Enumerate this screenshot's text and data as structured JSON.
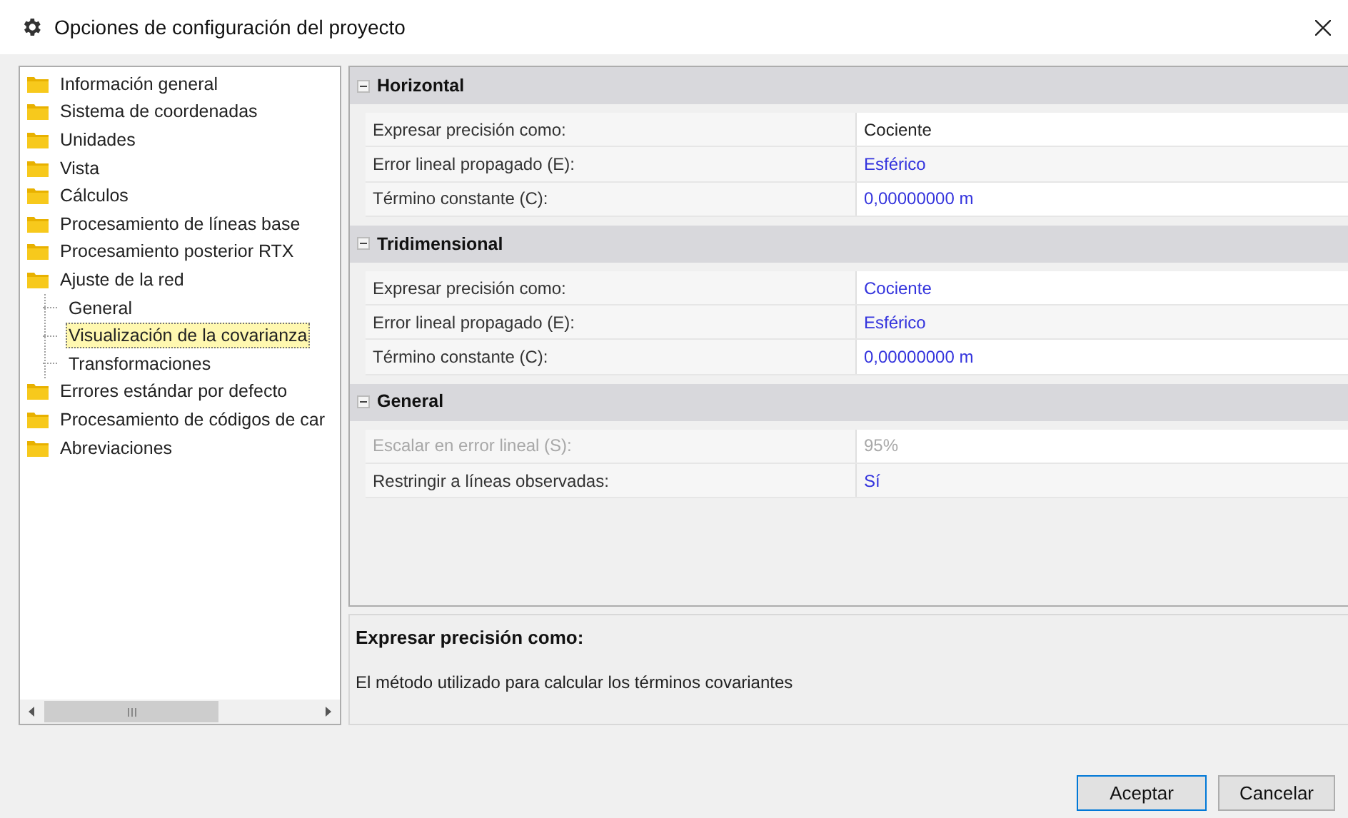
{
  "window": {
    "title": "Opciones de configuración del proyecto"
  },
  "tree": [
    {
      "label": "Información general",
      "selected": false
    },
    {
      "label": "Sistema de coordenadas",
      "selected": false
    },
    {
      "label": "Unidades",
      "selected": false
    },
    {
      "label": "Vista",
      "selected": false
    },
    {
      "label": "Cálculos",
      "selected": false
    },
    {
      "label": "Procesamiento de líneas base",
      "selected": false
    },
    {
      "label": "Procesamiento posterior RTX",
      "selected": false
    },
    {
      "label": "Ajuste de la red",
      "selected": false,
      "expanded": true,
      "children": [
        {
          "label": "General",
          "selected": false
        },
        {
          "label": "Visualización de la covarianza",
          "selected": true
        },
        {
          "label": "Transformaciones",
          "selected": false
        }
      ]
    },
    {
      "label": "Errores estándar por defecto",
      "selected": false
    },
    {
      "label": "Procesamiento de códigos de car",
      "selected": false
    },
    {
      "label": "Abreviaciones",
      "selected": false
    }
  ],
  "property_grid": [
    {
      "title": "Horizontal",
      "expanded": true,
      "rows": [
        {
          "label": "Expresar precisión como:",
          "value": "Cociente",
          "modified": false,
          "disabled": false
        },
        {
          "label": "Error lineal propagado (E):",
          "value": "Esférico",
          "modified": true,
          "disabled": false
        },
        {
          "label": "Término constante (C):",
          "value": "0,00000000 m",
          "modified": true,
          "disabled": false
        }
      ]
    },
    {
      "title": "Tridimensional",
      "expanded": true,
      "rows": [
        {
          "label": "Expresar precisión como:",
          "value": "Cociente",
          "modified": true,
          "disabled": false
        },
        {
          "label": "Error lineal propagado (E):",
          "value": "Esférico",
          "modified": true,
          "disabled": false
        },
        {
          "label": "Término constante (C):",
          "value": "0,00000000 m",
          "modified": true,
          "disabled": false
        }
      ]
    },
    {
      "title": "General",
      "expanded": true,
      "rows": [
        {
          "label": "Escalar en error lineal (S):",
          "value": "95%",
          "disabled": true
        },
        {
          "label": "Restringir a líneas observadas:",
          "value": "Sí",
          "modified": true,
          "disabled": false
        }
      ]
    }
  ],
  "description": {
    "title": "Expresar precisión como:",
    "text": "El método utilizado para calcular los términos covariantes"
  },
  "buttons": [
    {
      "label": "Aceptar",
      "default": true
    },
    {
      "label": "Cancelar",
      "default": false
    }
  ]
}
